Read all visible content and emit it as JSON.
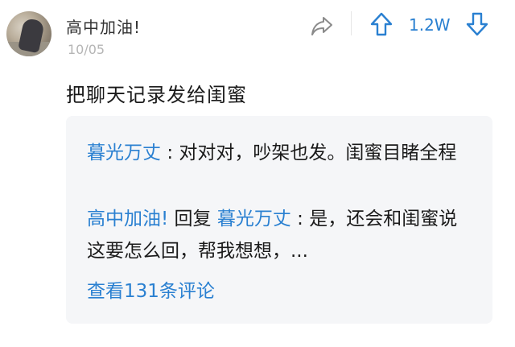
{
  "post": {
    "username": "高中加油!",
    "date": "10/05",
    "vote_count": "1.2W",
    "text": "把聊天记录发给闺蜜"
  },
  "replies": [
    {
      "author": "暮光万丈",
      "separator": ":",
      "text": "对对对，吵架也发。闺蜜目睹全程"
    },
    {
      "author": "高中加油!",
      "reply_word": "回复",
      "reply_to": "暮光万丈",
      "separator": ":",
      "text": "是，还会和闺蜜说这要怎么回，帮我想想，..."
    }
  ],
  "view_more": "查看131条评论",
  "icons": {
    "share": "share-arrow-icon",
    "upvote": "upvote-arrow-icon",
    "downvote": "downvote-arrow-icon"
  },
  "colors": {
    "accent": "#2a80d1",
    "text": "#1a1a1a",
    "muted": "#b5b5b5",
    "reply_bg": "#f5f6f8"
  }
}
